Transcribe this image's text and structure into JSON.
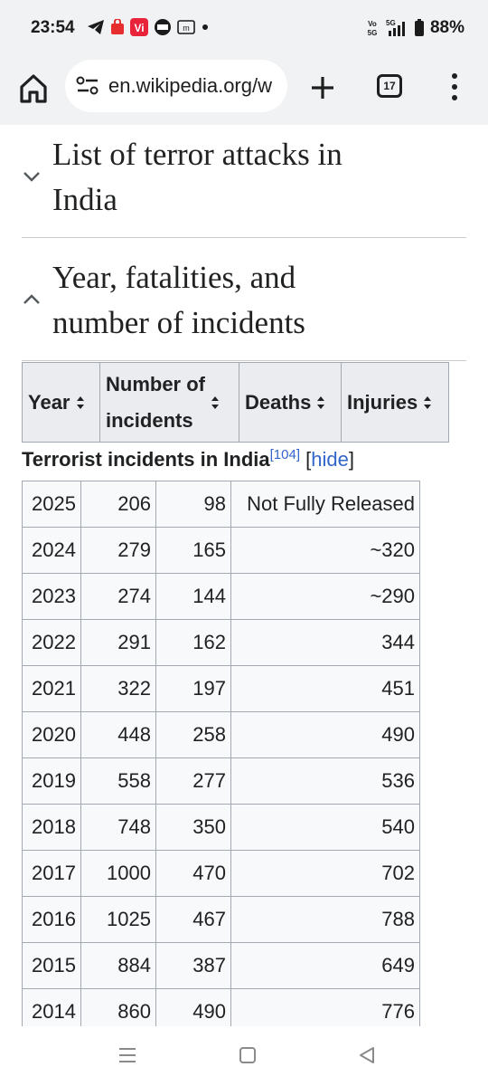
{
  "status_bar": {
    "time": "23:54",
    "icons": [
      "telegram-icon",
      "shopping-bag-icon",
      "vi-app-icon",
      "news-app-icon",
      "m-app-icon",
      "notification-dot-icon"
    ],
    "network": "Vo 5G",
    "network_gen": "5G",
    "battery": "88%"
  },
  "toolbar": {
    "url": "en.wikipedia.org/w",
    "tab_count": "17"
  },
  "sections": [
    {
      "title_line1": "List of terror attacks in",
      "title_line2": "India",
      "state": "collapsed"
    },
    {
      "title_line1": "Year, fatalities, and",
      "title_line2": "number of incidents",
      "state": "expanded"
    }
  ],
  "table": {
    "headers": {
      "year": "Year",
      "incidents_line1": "Number of",
      "incidents_line2": "incidents",
      "deaths": "Deaths",
      "injuries": "Injuries"
    },
    "caption": "Terrorist incidents in India",
    "citation": "[104]",
    "hide_open": "[",
    "hide_label": "hide",
    "hide_close": "]",
    "rows": [
      {
        "year": "2025",
        "incidents": "206",
        "deaths": "98",
        "injuries": "Not Fully Released"
      },
      {
        "year": "2024",
        "incidents": "279",
        "deaths": "165",
        "injuries": "~320"
      },
      {
        "year": "2023",
        "incidents": "274",
        "deaths": "144",
        "injuries": "~290"
      },
      {
        "year": "2022",
        "incidents": "291",
        "deaths": "162",
        "injuries": "344"
      },
      {
        "year": "2021",
        "incidents": "322",
        "deaths": "197",
        "injuries": "451"
      },
      {
        "year": "2020",
        "incidents": "448",
        "deaths": "258",
        "injuries": "490"
      },
      {
        "year": "2019",
        "incidents": "558",
        "deaths": "277",
        "injuries": "536"
      },
      {
        "year": "2018",
        "incidents": "748",
        "deaths": "350",
        "injuries": "540"
      },
      {
        "year": "2017",
        "incidents": "1000",
        "deaths": "470",
        "injuries": "702"
      },
      {
        "year": "2016",
        "incidents": "1025",
        "deaths": "467",
        "injuries": "788"
      },
      {
        "year": "2015",
        "incidents": "884",
        "deaths": "387",
        "injuries": "649"
      },
      {
        "year": "2014",
        "incidents": "860",
        "deaths": "490",
        "injuries": "776"
      }
    ]
  },
  "nav_bar": {
    "buttons": [
      "recents-icon",
      "home-icon",
      "back-icon"
    ]
  },
  "colors": {
    "link": "#3366cc",
    "header_bg": "#eaecf0",
    "border": "#a2a9b1",
    "chrome_bg": "#f1f2f4"
  }
}
